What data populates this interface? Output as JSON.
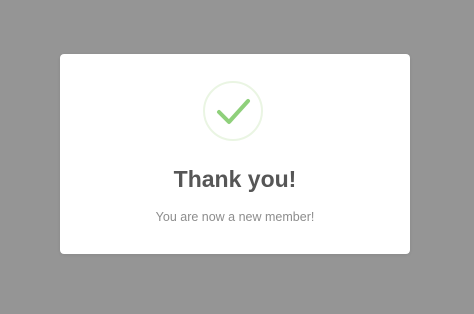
{
  "modal": {
    "icon": "checkmark-icon",
    "title": "Thank you!",
    "message": "You are now a new member!"
  },
  "colors": {
    "backdrop": "#959595",
    "check": "#8fd07b",
    "ring": "#eaf5e3",
    "title": "#565656",
    "message": "#8d8d8d"
  }
}
